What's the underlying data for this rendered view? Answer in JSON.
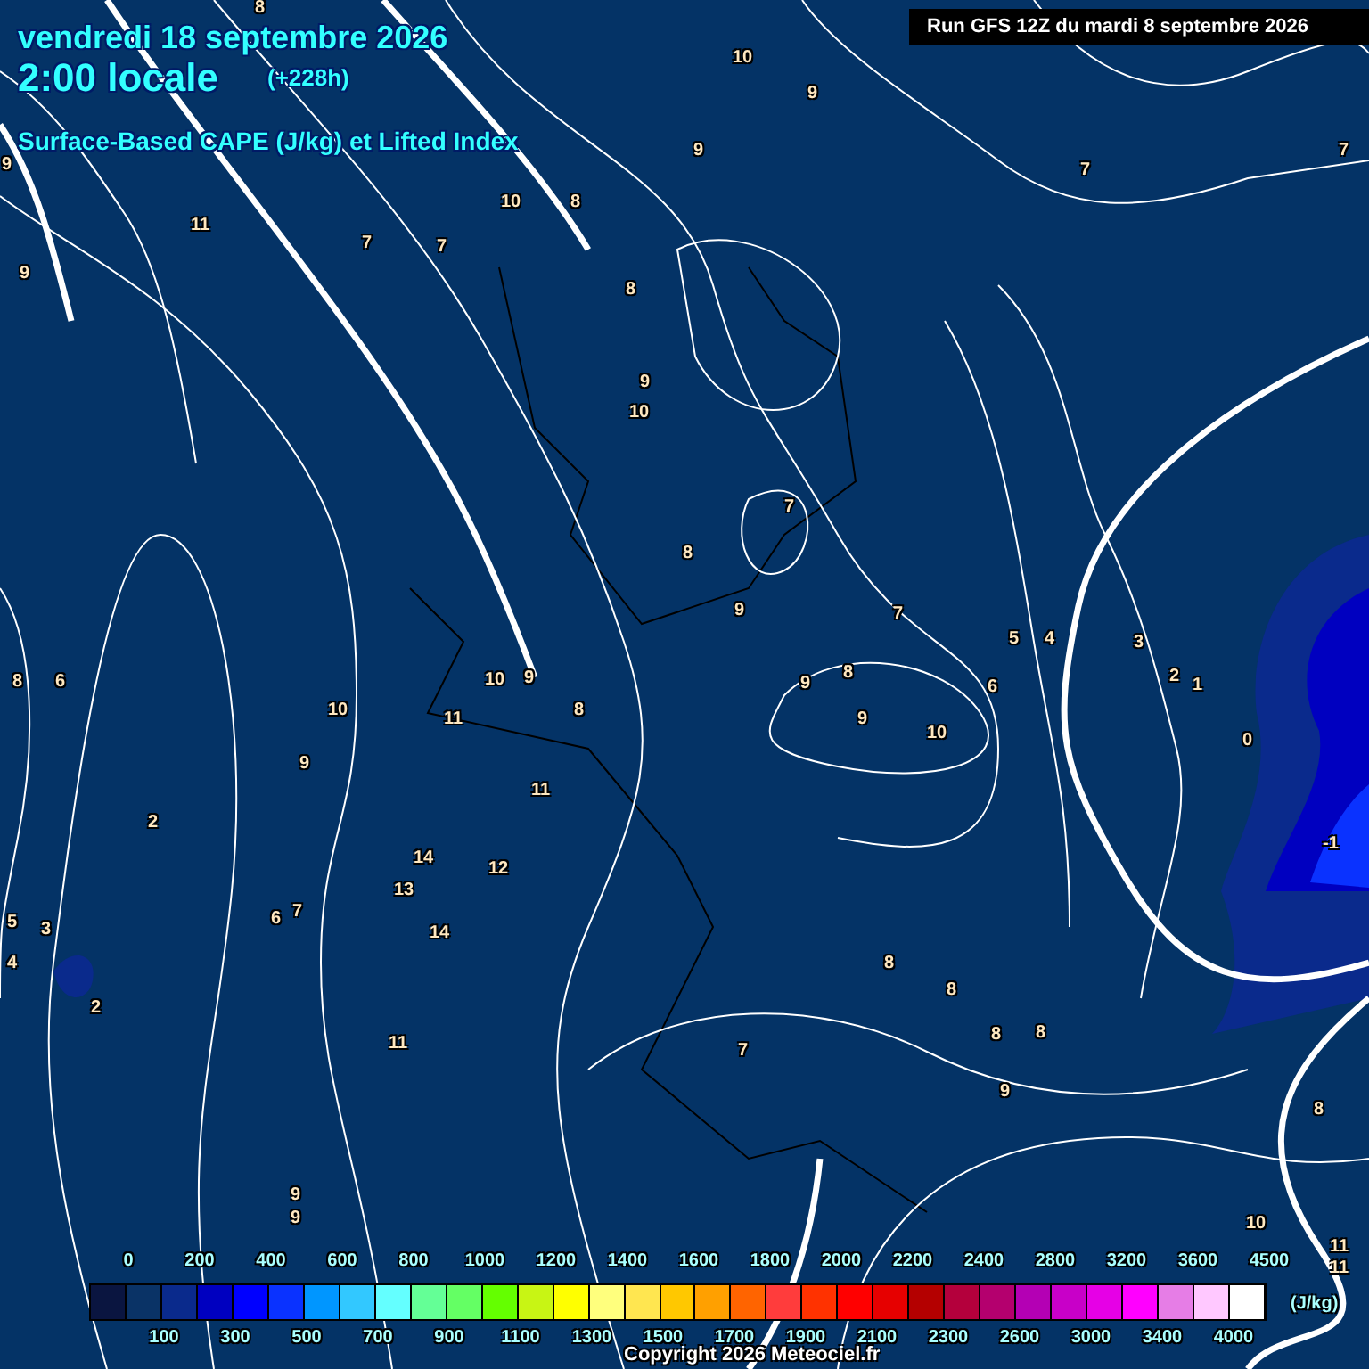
{
  "header": {
    "date": "vendredi 18 septembre 2026",
    "time": "2:00 locale",
    "lead": "(+228h)",
    "subtitle": "Surface-Based CAPE (J/kg) et Lifted Index"
  },
  "run_info": "Run GFS 12Z du mardi 8 septembre 2026",
  "map": {
    "contour_labels": [
      "8",
      "10",
      "9",
      "9",
      "9",
      "7",
      "7",
      "10",
      "8",
      "11",
      "7",
      "7",
      "9",
      "8",
      "9",
      "10",
      "7",
      "8",
      "9",
      "7",
      "5",
      "4",
      "3",
      "8",
      "6",
      "10",
      "9",
      "9",
      "8",
      "6",
      "2",
      "1",
      "10",
      "11",
      "8",
      "9",
      "10",
      "0",
      "9",
      "11",
      "2",
      "14",
      "12",
      "-1",
      "13",
      "5",
      "3",
      "6",
      "7",
      "14",
      "4",
      "8",
      "2",
      "8",
      "11",
      "7",
      "8",
      "8",
      "9",
      "8",
      "9",
      "9",
      "10",
      "11",
      "11"
    ]
  },
  "legend": {
    "items": [
      {
        "label": "0",
        "color": "#0a1540"
      },
      {
        "label": "100",
        "color": "#0a3366"
      },
      {
        "label": "200",
        "color": "#0a2a8c"
      },
      {
        "label": "300",
        "color": "#0000c0"
      },
      {
        "label": "400",
        "color": "#0000ff"
      },
      {
        "label": "500",
        "color": "#0a32ff"
      },
      {
        "label": "600",
        "color": "#0096ff"
      },
      {
        "label": "700",
        "color": "#32c8ff"
      },
      {
        "label": "800",
        "color": "#64ffff"
      },
      {
        "label": "900",
        "color": "#64ff96"
      },
      {
        "label": "1000",
        "color": "#64ff64"
      },
      {
        "label": "1100",
        "color": "#64ff00"
      },
      {
        "label": "1200",
        "color": "#c8f514"
      },
      {
        "label": "1300",
        "color": "#ffff00"
      },
      {
        "label": "1400",
        "color": "#ffff7d"
      },
      {
        "label": "1500",
        "color": "#ffe650"
      },
      {
        "label": "1600",
        "color": "#ffc800"
      },
      {
        "label": "1700",
        "color": "#ffa000"
      },
      {
        "label": "1800",
        "color": "#ff6400"
      },
      {
        "label": "1900",
        "color": "#ff3c3c"
      },
      {
        "label": "2000",
        "color": "#ff3200"
      },
      {
        "label": "2100",
        "color": "#ff0000"
      },
      {
        "label": "2200",
        "color": "#e60000"
      },
      {
        "label": "2300",
        "color": "#b40000"
      },
      {
        "label": "2400",
        "color": "#b4003c"
      },
      {
        "label": "2600",
        "color": "#b4006e"
      },
      {
        "label": "2800",
        "color": "#b400b4"
      },
      {
        "label": "3000",
        "color": "#c800c8"
      },
      {
        "label": "3200",
        "color": "#e600e6"
      },
      {
        "label": "3400",
        "color": "#ff00ff"
      },
      {
        "label": "3600",
        "color": "#e67de6"
      },
      {
        "label": "4000",
        "color": "#ffc8ff"
      },
      {
        "label": "4500",
        "color": "#ffffff"
      }
    ],
    "unit": "(J/kg)"
  },
  "copyright": "Copyright 2026 Meteociel.fr"
}
